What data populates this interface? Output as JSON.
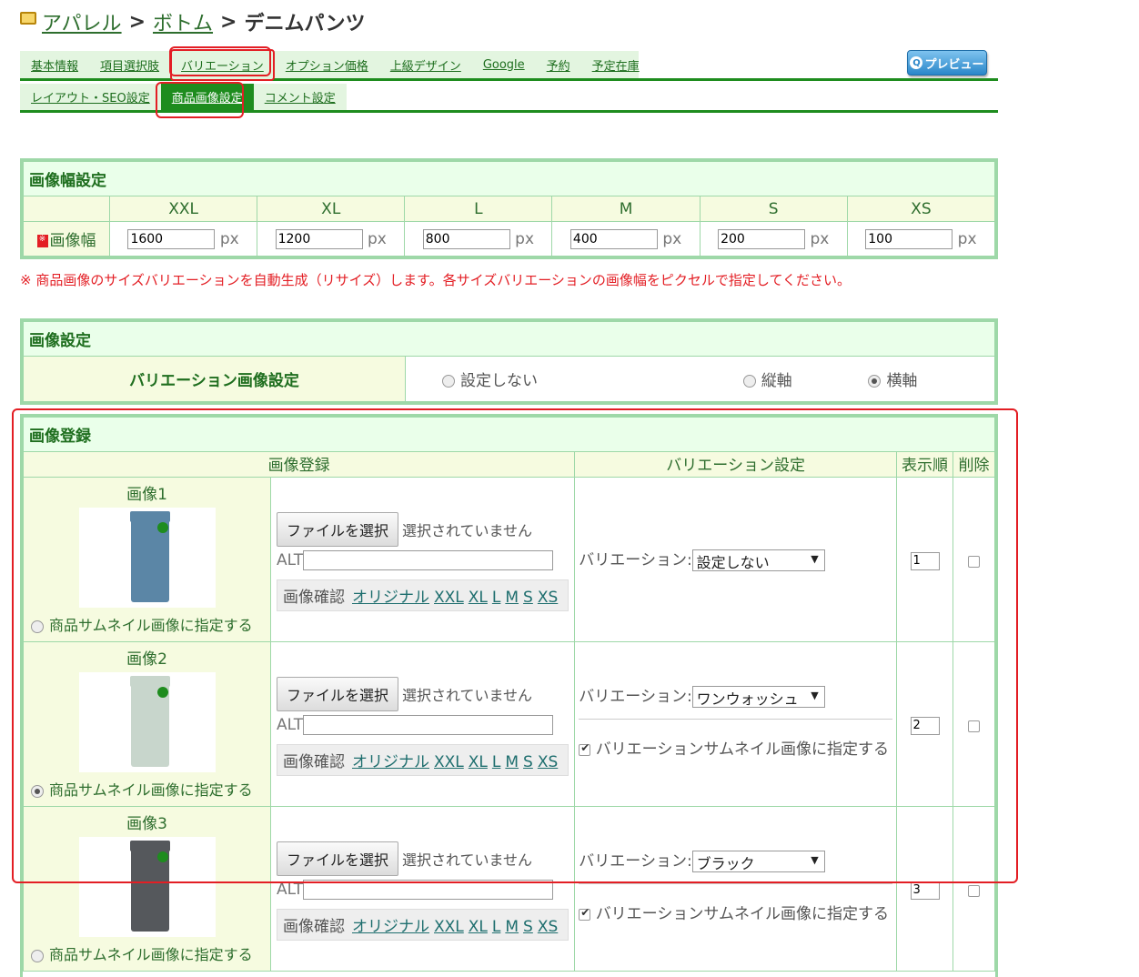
{
  "breadcrumb": {
    "items": [
      "アパレル",
      "ボトム"
    ],
    "separator": ">",
    "current": "デニムパンツ"
  },
  "tabs_main": [
    "基本情報",
    "項目選択肢",
    "バリエーション",
    "オプション価格",
    "上級デザイン",
    "Google",
    "予約",
    "予定在庫"
  ],
  "preview_label": "プレビュー",
  "tabs_sub": [
    "レイアウト・SEO設定",
    "商品画像設定",
    "コメント設定"
  ],
  "width_settings": {
    "title": "画像幅設定",
    "row_label": "画像幅",
    "required_mark": "※",
    "unit": "px",
    "sizes": [
      "XXL",
      "XL",
      "L",
      "M",
      "S",
      "XS"
    ],
    "values": [
      "1600",
      "1200",
      "800",
      "400",
      "200",
      "100"
    ]
  },
  "note": "※ 商品画像のサイズバリエーションを自動生成（リサイズ）します。各サイズバリエーションの画像幅をピクセルで指定してください。",
  "image_settings": {
    "title": "画像設定",
    "row_label": "バリエーション画像設定",
    "options": [
      "設定しない",
      "縦軸",
      "横軸"
    ],
    "selected": "横軸"
  },
  "image_registration": {
    "title": "画像登録",
    "headers": [
      "画像登録",
      "バリエーション設定",
      "表示順",
      "削除"
    ],
    "file_button": "ファイルを選択",
    "no_file": "選択されていません",
    "alt_label": "ALT",
    "confirm_label": "画像確認",
    "size_links": [
      "オリジナル",
      "XXL",
      "XL",
      "L",
      "M",
      "S",
      "XS"
    ],
    "thumb_label": "商品サムネイル画像に指定する",
    "variation_label": "バリエーション:",
    "variation_thumb_label": "バリエーションサムネイル画像に指定する",
    "rows": [
      {
        "name": "画像1",
        "variation": "設定しない",
        "order": "1",
        "thumb_selected": false,
        "variation_thumb": null,
        "color": "#5b86a6"
      },
      {
        "name": "画像2",
        "variation": "ワンウォッシュ",
        "order": "2",
        "thumb_selected": true,
        "variation_thumb": true,
        "color": "#c8d6cc"
      },
      {
        "name": "画像3",
        "variation": "ブラック",
        "order": "3",
        "thumb_selected": false,
        "variation_thumb": true,
        "color": "#55585c"
      }
    ]
  }
}
